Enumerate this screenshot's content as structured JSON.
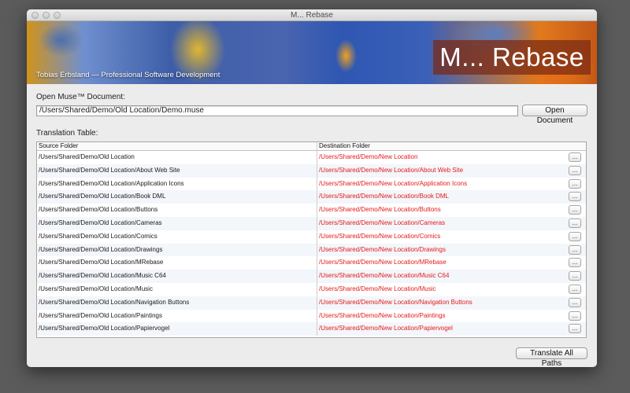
{
  "window": {
    "title": "M... Rebase"
  },
  "banner": {
    "credit": "Tobias Erbsland — Professional Software Development",
    "logo": "M... Rebase"
  },
  "open": {
    "label": "Open Muse™ Document:",
    "path_value": "/Users/Shared/Demo/Old Location/Demo.muse",
    "button_label": "Open Document"
  },
  "table": {
    "label": "Translation Table:",
    "headers": {
      "source": "Source Folder",
      "destination": "Destination Folder"
    },
    "browse_label": "...",
    "rows": [
      {
        "source": "/Users/Shared/Demo/Old Location",
        "destination": "/Users/Shared/Demo/New Location"
      },
      {
        "source": "/Users/Shared/Demo/Old Location/About Web Site",
        "destination": "/Users/Shared/Demo/New Location/About Web Site"
      },
      {
        "source": "/Users/Shared/Demo/Old Location/Application Icons",
        "destination": "/Users/Shared/Demo/New Location/Application Icons"
      },
      {
        "source": "/Users/Shared/Demo/Old Location/Book DML",
        "destination": "/Users/Shared/Demo/New Location/Book DML"
      },
      {
        "source": "/Users/Shared/Demo/Old Location/Buttons",
        "destination": "/Users/Shared/Demo/New Location/Buttons"
      },
      {
        "source": "/Users/Shared/Demo/Old Location/Cameras",
        "destination": "/Users/Shared/Demo/New Location/Cameras"
      },
      {
        "source": "/Users/Shared/Demo/Old Location/Comics",
        "destination": "/Users/Shared/Demo/New Location/Comics"
      },
      {
        "source": "/Users/Shared/Demo/Old Location/Drawings",
        "destination": "/Users/Shared/Demo/New Location/Drawings"
      },
      {
        "source": "/Users/Shared/Demo/Old Location/MRebase",
        "destination": "/Users/Shared/Demo/New Location/MRebase"
      },
      {
        "source": "/Users/Shared/Demo/Old Location/Music C64",
        "destination": "/Users/Shared/Demo/New Location/Music C64"
      },
      {
        "source": "/Users/Shared/Demo/Old Location/Music",
        "destination": "/Users/Shared/Demo/New Location/Music"
      },
      {
        "source": "/Users/Shared/Demo/Old Location/Navigation Buttons",
        "destination": "/Users/Shared/Demo/New Location/Navigation Buttons"
      },
      {
        "source": "/Users/Shared/Demo/Old Location/Paintings",
        "destination": "/Users/Shared/Demo/New Location/Paintings"
      },
      {
        "source": "/Users/Shared/Demo/Old Location/Papiervogel",
        "destination": "/Users/Shared/Demo/New Location/Papiervogel"
      }
    ]
  },
  "footer": {
    "translate_button_label": "Translate All Paths"
  },
  "colors": {
    "destination_text": "#e41a1a",
    "desktop_background": "#5b5b5b"
  }
}
